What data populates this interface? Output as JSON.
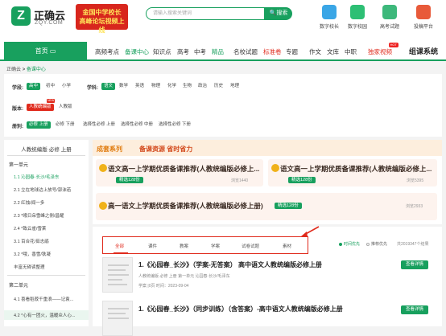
{
  "header": {
    "logo_mark": "Z",
    "logo_name": "正确云",
    "logo_domain": "ZQY.COM",
    "banner_line1": "金国中学校长",
    "banner_line2": "高峰论坛视频上线",
    "search_placeholder": "请输入搜索关键词",
    "search_button": "搜索",
    "tools": [
      "数字校长",
      "数字校园",
      "高考试题",
      "投稿平台"
    ],
    "tool_colors": [
      "#3aa6e6",
      "#2dbf74",
      "#3db87b",
      "#e85a3a"
    ]
  },
  "nav": {
    "home": "首页",
    "items": [
      "高频考点",
      "备课中心",
      "知识点",
      "高考",
      "中考",
      "精品",
      "名校试题",
      "标准卷",
      "专题",
      "作文",
      "文库",
      "中职",
      "独家视频"
    ],
    "hot_badge": "HOT",
    "right_label": "组课系统"
  },
  "breadcrumb": {
    "home": "正确云",
    "sep": ">",
    "current": "备课中心"
  },
  "filters": {
    "stage_label": "学段:",
    "stages": [
      "高中",
      "初中",
      "小学"
    ],
    "subject_label": "学科:",
    "subjects": [
      "语文",
      "数学",
      "英语",
      "物理",
      "化学",
      "生物",
      "政治",
      "历史",
      "地理"
    ],
    "version_label": "版本:",
    "versions": [
      "人教统编版",
      "人教版"
    ],
    "new_tag": "NEW",
    "volume_label": "册别:",
    "volumes": [
      "必修 上册",
      "必修 下册",
      "选择性必修 上册",
      "选择性必修 中册",
      "选择性必修 下册"
    ]
  },
  "sidebar": {
    "title": "人教统编版·必修 上册",
    "unit1": "第一单元",
    "unit1_items": [
      "1.1 沁园春·长沙/毛泽东",
      "2.1 立在地球边上放号/郭沫若",
      "2.2 红烛/闻一多",
      "2.3 *峨日朵雪峰之侧/昌耀",
      "2.4 *致云雀/雪莱",
      "3.1 百合花/茹志鹃",
      "3.2 *哦，香雪/铁凝",
      "丰富无碍读整理"
    ],
    "unit2": "第二单元",
    "unit2_items": [
      "4.1 喜看稻菽千重浪——记袁...",
      "4.2 *心有一团火，温暖众人心..."
    ]
  },
  "series": {
    "head_a": "成套系列",
    "head_b": "备课资源 省时省力",
    "cards": [
      {
        "title": "语文高一上学期优质备课推荐(人教统编版必修上...",
        "price": "精选128份",
        "views": "浏览1440"
      },
      {
        "title": "语文高一上学期优质备课推荐(人教统编版必修上...",
        "price": "精选128份",
        "views": "浏览5395"
      },
      {
        "title": "高一语文上学期优质备课推荐(人教统编版必修上册)",
        "price": "精选128份",
        "views": "浏览2933"
      }
    ]
  },
  "list": {
    "tabs": [
      "全部",
      "课件",
      "教案",
      "学案",
      "试卷试题",
      "素材"
    ],
    "sort": [
      "时间优先",
      "推荐优先"
    ],
    "count": "共2019347个结果",
    "items": [
      {
        "title": "1.《沁园春_长沙》（学案-无答案） 高中语文人教统编版必修上册",
        "meta1": "人教统编版  必修 上册  第一单元  沁园春·长沙/毛泽东",
        "meta2": "学案 |0页  时间：2023-09-04",
        "button": "查看详情"
      },
      {
        "title": "1.《沁园春_长沙》（同步训练）（含答案）-高中语文人教统编版必修上册",
        "meta1": "",
        "meta2": "",
        "button": "查看详情"
      }
    ]
  }
}
